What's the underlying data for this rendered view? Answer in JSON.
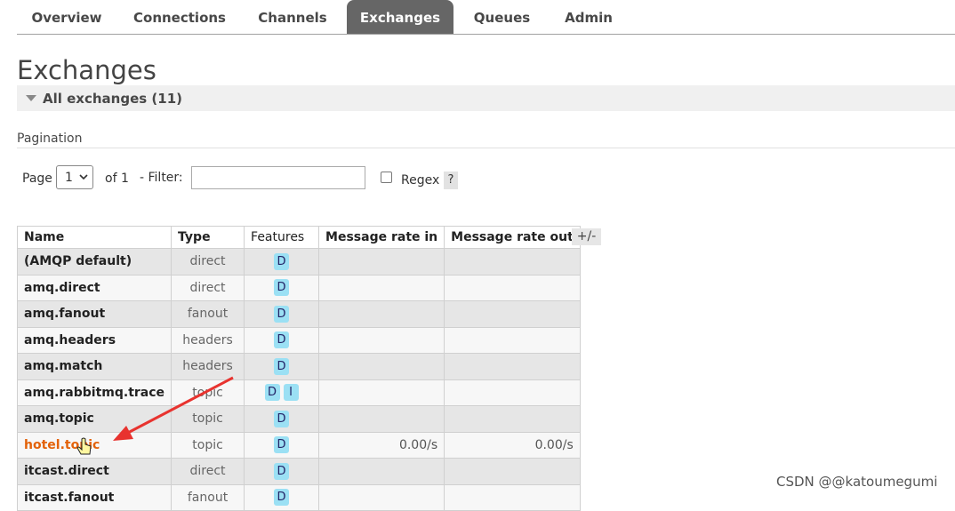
{
  "nav": {
    "tabs": [
      {
        "label": "Overview",
        "active": false
      },
      {
        "label": "Connections",
        "active": false
      },
      {
        "label": "Channels",
        "active": false
      },
      {
        "label": "Exchanges",
        "active": true
      },
      {
        "label": "Queues",
        "active": false
      },
      {
        "label": "Admin",
        "active": false
      }
    ]
  },
  "page": {
    "title": "Exchanges",
    "section": "All exchanges (11)"
  },
  "pagination": {
    "title": "Pagination",
    "page_label": "Page",
    "page_value": "1",
    "of_label": "of 1",
    "filter_label": "- Filter:",
    "filter_value": "",
    "regex_label": "Regex",
    "regex_checked": false,
    "help_label": "?"
  },
  "table": {
    "headers": [
      "Name",
      "Type",
      "Features",
      "Message rate in",
      "Message rate out"
    ],
    "column_toggle": "+/-",
    "rows": [
      {
        "name": "(AMQP default)",
        "type": "direct",
        "features": [
          "D"
        ],
        "rate_in": "",
        "rate_out": ""
      },
      {
        "name": "amq.direct",
        "type": "direct",
        "features": [
          "D"
        ],
        "rate_in": "",
        "rate_out": ""
      },
      {
        "name": "amq.fanout",
        "type": "fanout",
        "features": [
          "D"
        ],
        "rate_in": "",
        "rate_out": ""
      },
      {
        "name": "amq.headers",
        "type": "headers",
        "features": [
          "D"
        ],
        "rate_in": "",
        "rate_out": ""
      },
      {
        "name": "amq.match",
        "type": "headers",
        "features": [
          "D"
        ],
        "rate_in": "",
        "rate_out": ""
      },
      {
        "name": "amq.rabbitmq.trace",
        "type": "topic",
        "features": [
          "D",
          "I"
        ],
        "rate_in": "",
        "rate_out": ""
      },
      {
        "name": "amq.topic",
        "type": "topic",
        "features": [
          "D"
        ],
        "rate_in": "",
        "rate_out": ""
      },
      {
        "name": "hotel.topic",
        "type": "topic",
        "features": [
          "D"
        ],
        "rate_in": "0.00/s",
        "rate_out": "0.00/s",
        "highlighted": true
      },
      {
        "name": "itcast.direct",
        "type": "direct",
        "features": [
          "D"
        ],
        "rate_in": "",
        "rate_out": ""
      },
      {
        "name": "itcast.fanout",
        "type": "fanout",
        "features": [
          "D"
        ],
        "rate_in": "",
        "rate_out": ""
      }
    ]
  },
  "watermark": "CSDN @@katoumegumi",
  "colors": {
    "active_tab": "#666666",
    "link": "#e36209",
    "badge": "#9be0f4",
    "arrow": "#e8332f"
  }
}
